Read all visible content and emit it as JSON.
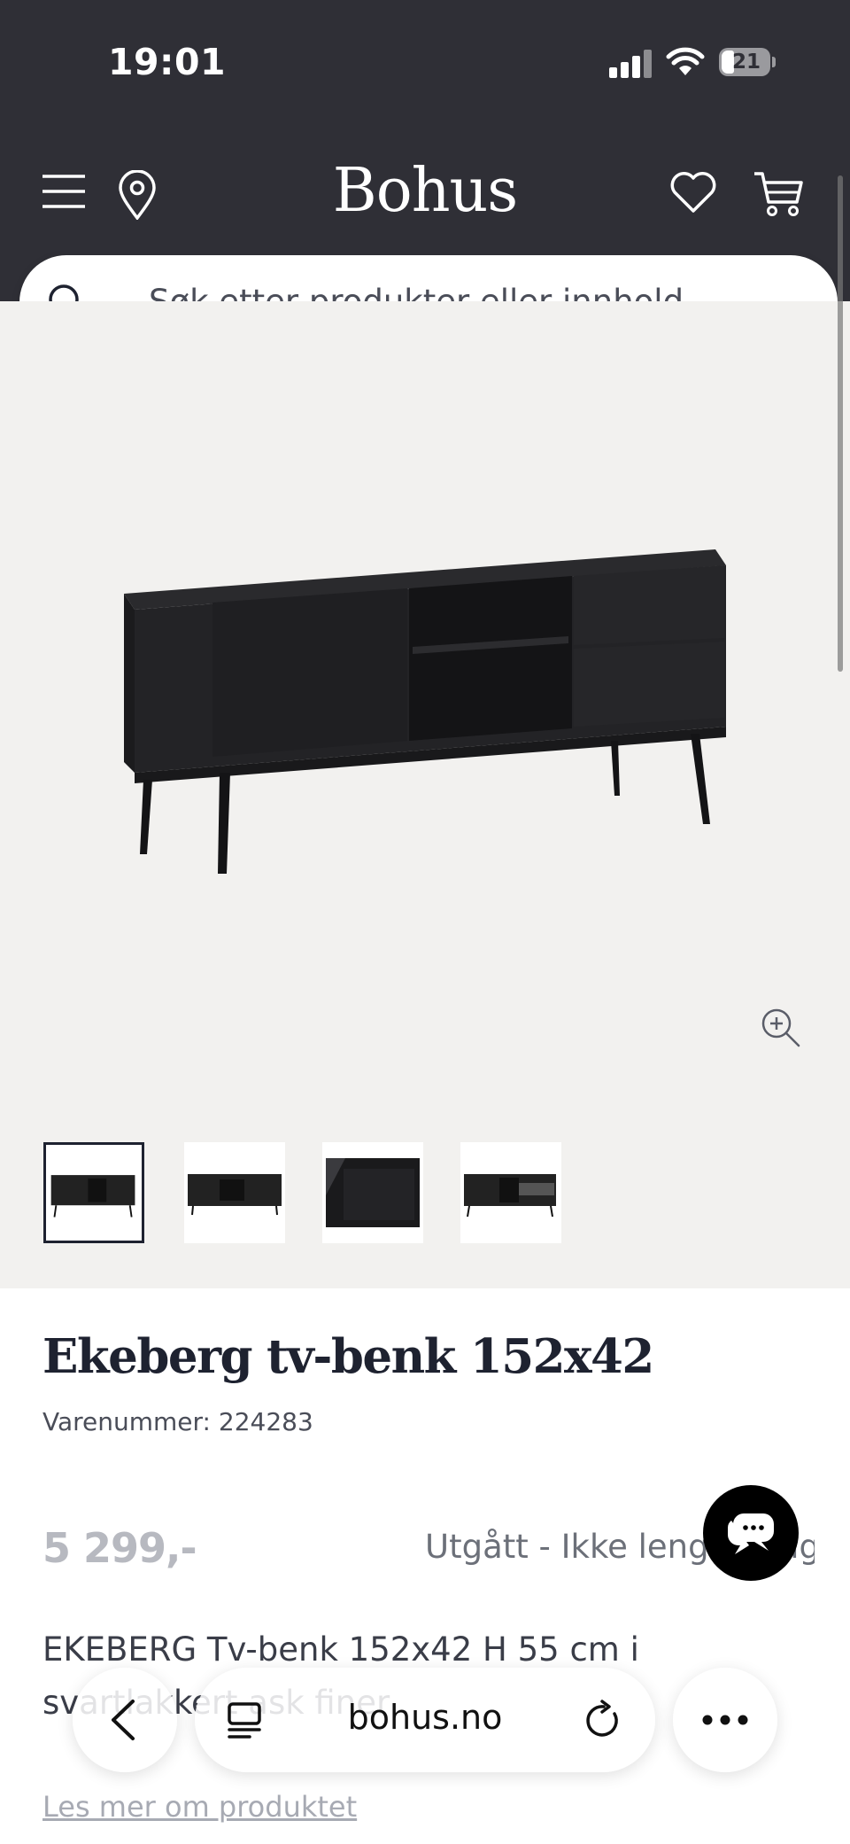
{
  "status_bar": {
    "time": "19:01",
    "battery": "21"
  },
  "header": {
    "logo": "Bohus"
  },
  "search": {
    "placeholder": "Søk etter produkter eller innhold..."
  },
  "gallery": {
    "thumbnail_count": 4,
    "active_index": 0
  },
  "product": {
    "title": "Ekeberg tv-benk 152x42",
    "sku_label": "Varenummer: ",
    "sku": "224283",
    "price": "5 299,-",
    "availability": "Utgått - Ikke lenger salg",
    "description": "EKEBERG Tv-benk 152x42 H 55 cm i svartlakkert ask finer",
    "read_more": "Les mer om produktet"
  },
  "browser": {
    "url": "bohus.no"
  },
  "colors": {
    "header_bg": "#2f2f36",
    "image_bg": "#f2f1ef",
    "title": "#1e2230",
    "price_muted": "#b7b9c0"
  },
  "icons": [
    "menu-icon",
    "location-pin-icon",
    "heart-icon",
    "cart-icon",
    "search-icon",
    "zoom-in-icon",
    "chat-icon",
    "back-arrow-icon",
    "reader-icon",
    "reload-icon",
    "more-icon"
  ]
}
